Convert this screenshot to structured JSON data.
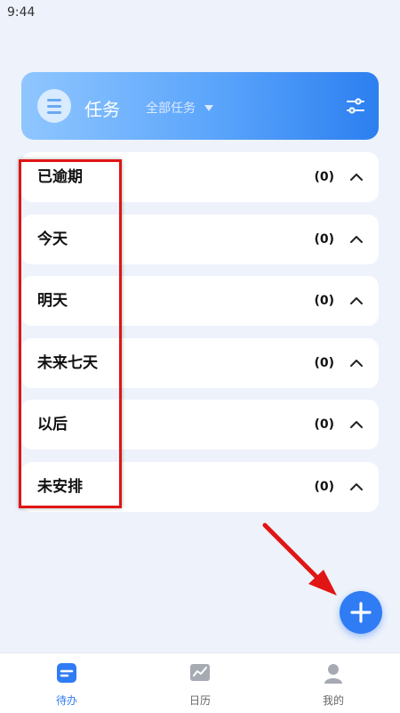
{
  "status_bar": {
    "time": "9:44"
  },
  "header": {
    "title": "任务",
    "filter_label": "全部任务",
    "menu_icon": "menu-icon",
    "settings_icon": "sliders-icon"
  },
  "groups": [
    {
      "name": "已逾期",
      "count": "(0)"
    },
    {
      "name": "今天",
      "count": "(0)"
    },
    {
      "name": "明天",
      "count": "(0)"
    },
    {
      "name": "未来七天",
      "count": "(0)"
    },
    {
      "name": "以后",
      "count": "(0)"
    },
    {
      "name": "未安排",
      "count": "(0)"
    }
  ],
  "fab": {
    "icon": "plus-icon"
  },
  "bottom_nav": [
    {
      "label": "待办",
      "icon": "todo-icon",
      "active": true
    },
    {
      "label": "日历",
      "icon": "calendar-chart-icon",
      "active": false
    },
    {
      "label": "我的",
      "icon": "profile-icon",
      "active": false
    }
  ],
  "colors": {
    "accent": "#2f7cf4",
    "header_gradient_start": "#8fc6ff",
    "header_gradient_end": "#2c7ff0",
    "annotation_red": "#e11515",
    "background": "#eef2fb"
  }
}
